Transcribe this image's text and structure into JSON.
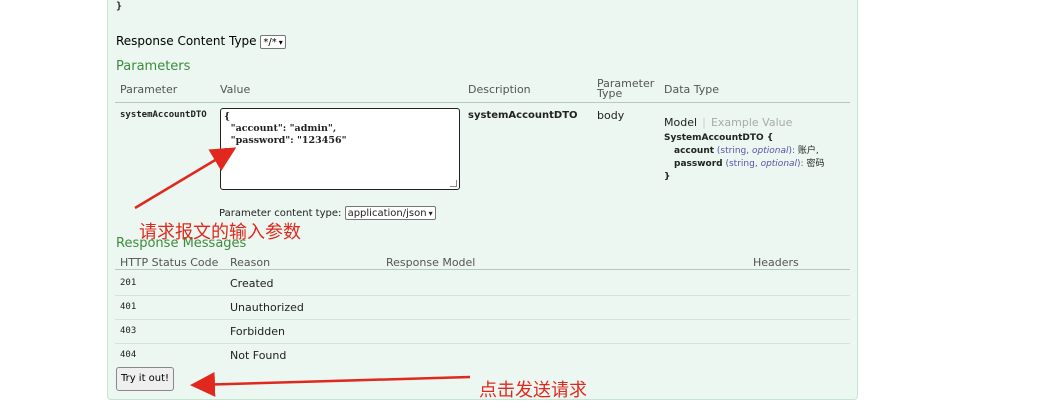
{
  "top_brace": "}",
  "response_content_type": {
    "label": "Response Content Type",
    "value": "*/*"
  },
  "parameters": {
    "heading": "Parameters",
    "columns": [
      "Parameter",
      "Value",
      "Description",
      "Parameter\nType",
      "Data Type"
    ],
    "column_type_line1": "Parameter",
    "column_type_line2": "Type",
    "row": {
      "name": "systemAccountDTO",
      "value_lines": [
        "{",
        "  \"account\": \"admin\",",
        "  \"password\": \"123456\"",
        "}"
      ],
      "description": "systemAccountDTO",
      "param_type": "body",
      "model_tab": "Model",
      "example_tab": "Example Value",
      "model_name": "SystemAccountDTO {",
      "fields": [
        {
          "name": "account",
          "type": "(string, ",
          "optional": "optional",
          "close": "): ",
          "desc": "账户,"
        },
        {
          "name": "password",
          "type": "(string, ",
          "optional": "optional",
          "close": "): ",
          "desc": "密码"
        }
      ],
      "model_close": "}"
    },
    "content_type_label": "Parameter content type:",
    "content_type_value": "application/json"
  },
  "response_messages": {
    "heading": "Response Messages",
    "columns": [
      "HTTP Status Code",
      "Reason",
      "Response Model",
      "Headers"
    ],
    "rows": [
      {
        "code": "201",
        "reason": "Created"
      },
      {
        "code": "401",
        "reason": "Unauthorized"
      },
      {
        "code": "403",
        "reason": "Forbidden"
      },
      {
        "code": "404",
        "reason": "Not Found"
      }
    ]
  },
  "try_button": "Try it out!",
  "annotations": {
    "input_params": "请求报文的输入参数",
    "send_request": "点击发送请求",
    "color": "#e0281e"
  },
  "colors": {
    "panel_bg": "#ebf7f0",
    "panel_border": "#c3e8d1",
    "heading_green": "#3c8b3c"
  }
}
